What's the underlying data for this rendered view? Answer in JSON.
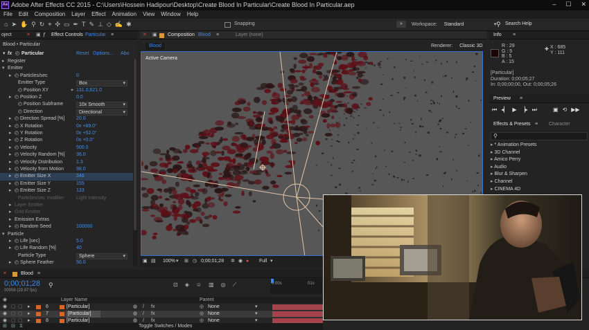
{
  "window": {
    "app_icon": "Ae",
    "title": "Adobe After Effects CC 2015 - C:\\Users\\Hossein Hadipour\\Desktop\\Create Blood In Particular\\Create Blood In Particular.aep",
    "controls": [
      "–",
      "☐",
      "✕"
    ]
  },
  "menu": [
    "File",
    "Edit",
    "Composition",
    "Layer",
    "Effect",
    "Animation",
    "View",
    "Window",
    "Help"
  ],
  "toolbar": {
    "snapping": "Snapping",
    "workspace_label": "Workspace:",
    "workspace_value": "Standard",
    "search": "Search Help"
  },
  "effect_controls": {
    "tab_project": "oject",
    "tab_label": "Effect Controls",
    "tab_layer": "Particular",
    "breadcrumb": "Blood • Particular",
    "fx_name": "Particular",
    "reset": "Reset",
    "options": "Options...",
    "about": "Abo",
    "rows": [
      {
        "label": "Register",
        "indent": 1,
        "tw": "▸"
      },
      {
        "label": "Emitter",
        "indent": 1,
        "tw": "▾"
      },
      {
        "label": "Particles/sec",
        "indent": 3,
        "tw": "▸",
        "sw": true,
        "value": "0"
      },
      {
        "label": "Emitter Type",
        "indent": 4,
        "dropdown": "Box"
      },
      {
        "label": "Position XY",
        "indent": 4,
        "sw": true,
        "value": "131.0,621.0",
        "cross": true
      },
      {
        "label": "Position Z",
        "indent": 3,
        "tw": "▸",
        "sw": true,
        "value": "0.0"
      },
      {
        "label": "Position Subframe",
        "indent": 4,
        "sw": true,
        "dropdown": "10x Smooth"
      },
      {
        "label": "Direction",
        "indent": 4,
        "sw": true,
        "dropdown": "Directional"
      },
      {
        "label": "Direction Spread [%]",
        "indent": 3,
        "tw": "▸",
        "sw": true,
        "value": "20.0"
      },
      {
        "label": "X Rotation",
        "indent": 3,
        "tw": "▸",
        "sw": true,
        "value": "0x +89.0°"
      },
      {
        "label": "Y Rotation",
        "indent": 3,
        "tw": "▸",
        "sw": true,
        "value": "0x +52.0°"
      },
      {
        "label": "Z Rotation",
        "indent": 3,
        "tw": "▸",
        "sw": true,
        "value": "0x +0.0°"
      },
      {
        "label": "Velocity",
        "indent": 3,
        "tw": "▸",
        "sw": true,
        "value": "500.0"
      },
      {
        "label": "Velocity Random [%]",
        "indent": 3,
        "tw": "▸",
        "sw": true,
        "value": "36.0"
      },
      {
        "label": "Velocity Distribution",
        "indent": 3,
        "tw": "▸",
        "sw": true,
        "value": "1.3"
      },
      {
        "label": "Velocity from Motion",
        "indent": 3,
        "tw": "▸",
        "sw": true,
        "value": "98.0"
      },
      {
        "label": "Emitter Size X",
        "indent": 3,
        "tw": "▸",
        "sw": true,
        "value": "346",
        "selected": true
      },
      {
        "label": "Emitter Size Y",
        "indent": 3,
        "tw": "▸",
        "sw": true,
        "value": "155"
      },
      {
        "label": "Emitter Size Z",
        "indent": 3,
        "tw": "▸",
        "sw": true,
        "value": "133"
      },
      {
        "label": "Particles/sec modifier",
        "indent": 4,
        "disabled": true,
        "value": "Light Intensity"
      },
      {
        "label": "Layer Emitter",
        "indent": 3,
        "tw": "▸",
        "disabled": true
      },
      {
        "label": "Grid Emitter",
        "indent": 3,
        "tw": "▸",
        "disabled": true
      },
      {
        "label": "Emission Extras",
        "indent": 3,
        "tw": "▸"
      },
      {
        "label": "Random Seed",
        "indent": 3,
        "tw": "▸",
        "sw": true,
        "value": "100000"
      },
      {
        "label": "Particle",
        "indent": 1,
        "tw": "▾"
      },
      {
        "label": "Life [sec]",
        "indent": 3,
        "tw": "▸",
        "sw": true,
        "value": "5.0"
      },
      {
        "label": "Life Random [%]",
        "indent": 3,
        "tw": "▸",
        "sw": true,
        "value": "40"
      },
      {
        "label": "Particle Type",
        "indent": 4,
        "dropdown": "Sphere"
      },
      {
        "label": "Sphere Feather",
        "indent": 3,
        "tw": "▸",
        "sw": true,
        "value": "50.0"
      }
    ]
  },
  "composition": {
    "tab_label": "Composition",
    "tab_name": "Blood",
    "layer_tab": "Layer (none)",
    "comp_chip": "Blood",
    "renderer_label": "Renderer:",
    "renderer_value": "Classic 3D",
    "camera": "Active Camera",
    "zoom": "100%",
    "timecode": "0;00;01;28",
    "resolution": "Full",
    "accent": "#2f6fd6"
  },
  "info": {
    "title": "Info",
    "r": "R : 29",
    "g": "G : 5",
    "b": "B : 5",
    "a": "A : 15",
    "x": "X : 685",
    "y": "Y : 111",
    "layer": "[Particular]",
    "duration": "Duration: 0;00;05;27",
    "inout": "In: 0;00;00;00, Out: 0;00;05;26",
    "swatch": "#1d0505"
  },
  "preview": {
    "title": "Preview"
  },
  "effects_presets": {
    "tab": "Effects & Presets",
    "tab2": "Character",
    "search_placeholder": "",
    "items": [
      "* Animation Presets",
      "3D Channel",
      "Amico Perry",
      "Audio",
      "Blur & Sharpen",
      "Channel",
      "CINEMA 4D"
    ]
  },
  "timeline": {
    "comp_name": "Blood",
    "timecode": "0;00;01;28",
    "frames": "00058 (29.97 fps)",
    "col_layer_name": "Layer Name",
    "col_parent": "Parent",
    "ruler_start": "0:00s",
    "ruler_next": "01s",
    "layers": [
      {
        "num": "6",
        "name": "[Particular]",
        "parent": "None"
      },
      {
        "num": "7",
        "name": "[Particular]",
        "parent": "None",
        "selected": true
      },
      {
        "num": "8",
        "name": "[Particular]",
        "parent": "None"
      }
    ],
    "toggle_label": "Toggle Switches / Modes",
    "layer_color": "#d4682a",
    "bar_color": "#a5434c"
  }
}
